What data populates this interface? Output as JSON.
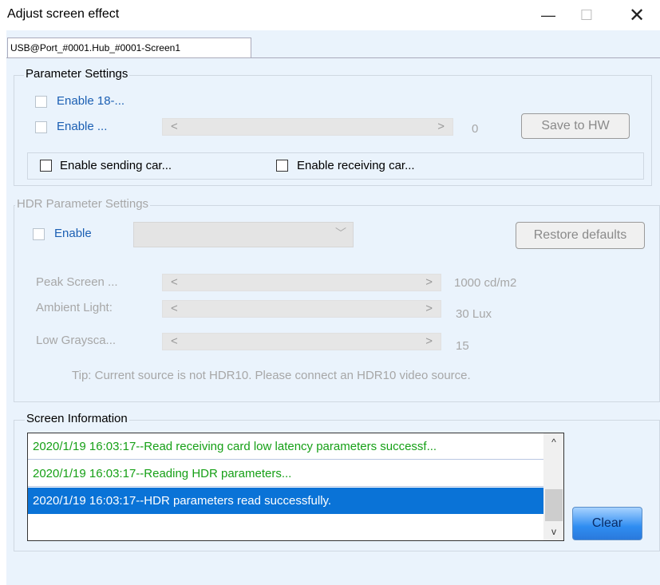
{
  "window": {
    "title": "Adjust screen effect",
    "min": "—",
    "max": "☐",
    "close": "✕"
  },
  "tab": {
    "label": "USB@Port_#0001.Hub_#0001-Screen1"
  },
  "parameter_settings": {
    "legend": "Parameter Settings",
    "enable18_label": "Enable 18-...",
    "enable_label": "Enable ...",
    "slider_value": "0",
    "save_button": "Save to HW",
    "enable_sending_label": "Enable sending car...",
    "enable_receiving_label": "Enable receiving car..."
  },
  "hdr_settings": {
    "legend": "HDR Parameter Settings",
    "enable_label": "Enable",
    "restore_button": "Restore defaults",
    "rows": [
      {
        "label": "Peak Screen ...",
        "value": "1000 cd/m2"
      },
      {
        "label": "Ambient Light:",
        "value": "30   Lux"
      },
      {
        "label": "Low Graysca...",
        "value": "15"
      }
    ],
    "tip": "Tip: Current source is not HDR10. Please connect an HDR10 video source."
  },
  "screen_information": {
    "legend": "Screen Information",
    "logs": [
      "2020/1/19 16:03:17--Read receiving card low latency parameters successf...",
      "2020/1/19 16:03:17--Reading HDR parameters...",
      "2020/1/19 16:03:17--HDR parameters read successfully."
    ],
    "clear_button": "Clear"
  },
  "icons": {
    "left": "<",
    "right": ">",
    "chevron": "﹀",
    "up": "^",
    "down": "v"
  },
  "colors": {
    "accent": "#0a73d7",
    "log_green": "#16a016",
    "label_blue": "#1b5fb3"
  }
}
